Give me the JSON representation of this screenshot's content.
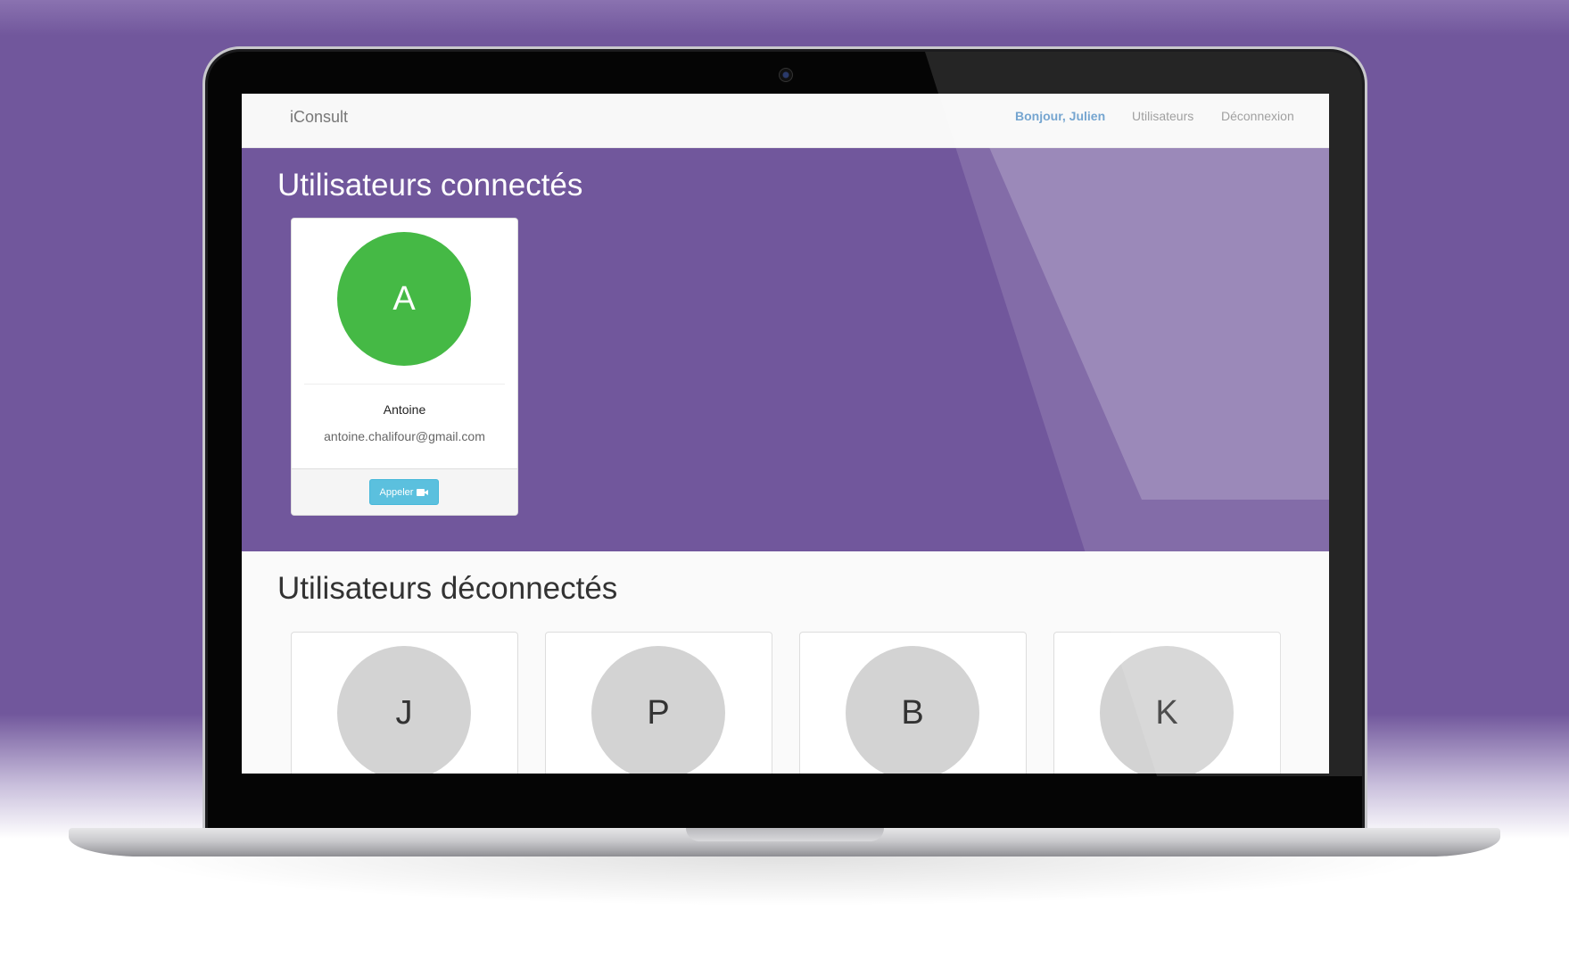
{
  "navbar": {
    "brand": "iConsult",
    "greeting": "Bonjour, Julien",
    "users_link": "Utilisateurs",
    "logout_link": "Déconnexion"
  },
  "connected": {
    "title": "Utilisateurs connectés",
    "users": [
      {
        "initial": "A",
        "name": "Antoine",
        "email": "antoine.chalifour@gmail.com",
        "call_label": "Appeler"
      }
    ]
  },
  "disconnected": {
    "title": "Utilisateurs déconnectés",
    "users": [
      {
        "initial": "J"
      },
      {
        "initial": "P"
      },
      {
        "initial": "B"
      },
      {
        "initial": "K"
      }
    ]
  },
  "colors": {
    "background_purple": "#71579c",
    "avatar_online": "#45b945",
    "avatar_offline": "#d3d3d3",
    "call_button": "#5bc0de",
    "nav_active": "#3a7fbd"
  },
  "icons": {
    "call_button_icon": "video-camera-icon"
  }
}
